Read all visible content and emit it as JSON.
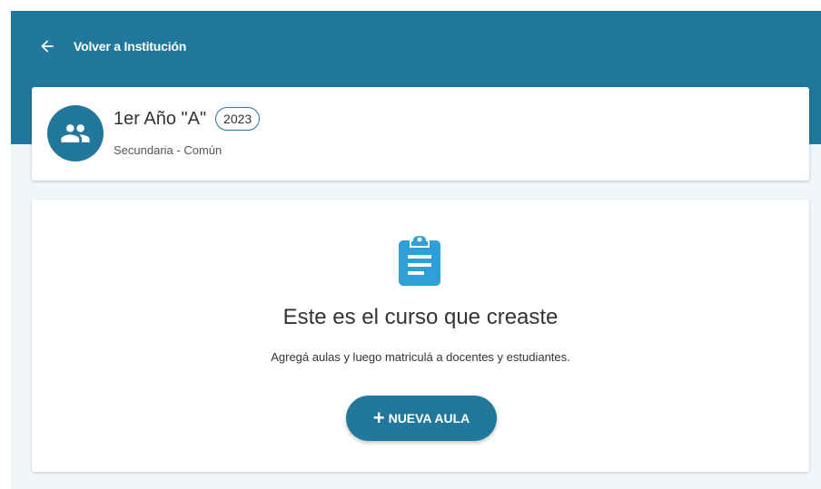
{
  "header": {
    "back_label": "Volver a Institución",
    "back_icon": "arrow-left-icon"
  },
  "course": {
    "avatar_icon": "group-icon",
    "name": "1er Año \"A\"",
    "year": "2023",
    "subtitle": "Secundaria - Común"
  },
  "empty_state": {
    "icon": "clipboard-icon",
    "title": "Este es el curso que creaste",
    "description": "Agregá aulas y luego matriculá a docentes y estudiantes.",
    "button_icon": "+",
    "button_label": "NUEVA AULA"
  },
  "colors": {
    "primary": "#22789b",
    "icon_blue": "#2f9fd8",
    "background": "#f1f6f9"
  }
}
